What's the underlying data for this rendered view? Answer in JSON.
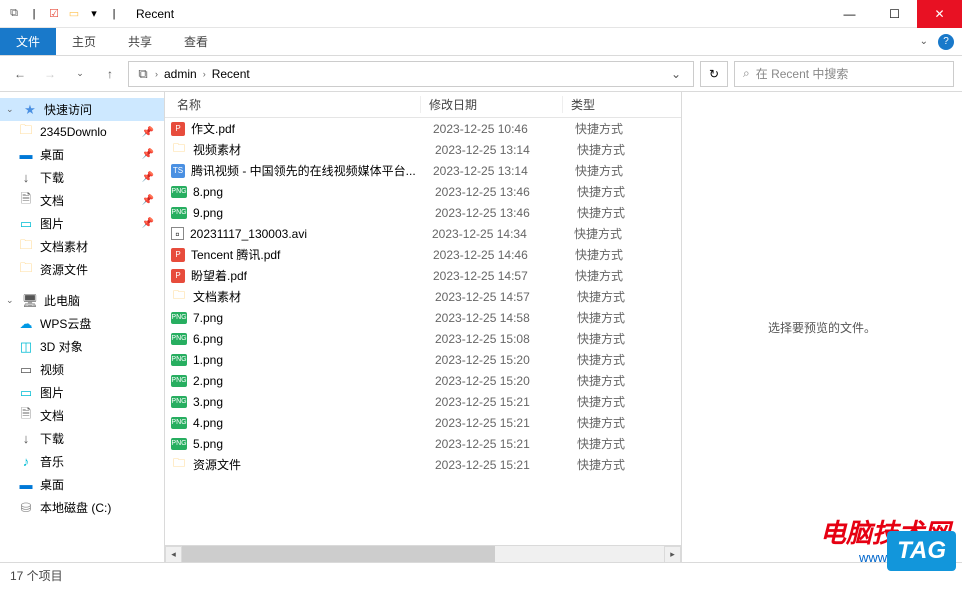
{
  "window": {
    "title": "Recent"
  },
  "ribbon": {
    "file": "文件",
    "home": "主页",
    "share": "共享",
    "view": "查看"
  },
  "address": {
    "seg1": "admin",
    "seg2": "Recent"
  },
  "search": {
    "placeholder": "在 Recent 中搜索"
  },
  "nav": {
    "quick_access": "快速访问",
    "items_quick": [
      {
        "label": "2345Downlo",
        "icon": "folder",
        "pin": true
      },
      {
        "label": "桌面",
        "icon": "desk",
        "pin": true
      },
      {
        "label": "下载",
        "icon": "down",
        "pin": true
      },
      {
        "label": "文档",
        "icon": "doc",
        "pin": true
      },
      {
        "label": "图片",
        "icon": "pic",
        "pin": true
      },
      {
        "label": "文档素材",
        "icon": "folder",
        "pin": false
      },
      {
        "label": "资源文件",
        "icon": "folder",
        "pin": false
      }
    ],
    "this_pc": "此电脑",
    "items_pc": [
      {
        "label": "WPS云盘",
        "icon": "wps"
      },
      {
        "label": "3D 对象",
        "icon": "3d"
      },
      {
        "label": "视频",
        "icon": "video"
      },
      {
        "label": "图片",
        "icon": "pic"
      },
      {
        "label": "文档",
        "icon": "doc"
      },
      {
        "label": "下载",
        "icon": "down"
      },
      {
        "label": "音乐",
        "icon": "music"
      },
      {
        "label": "桌面",
        "icon": "desk"
      },
      {
        "label": "本地磁盘 (C:)",
        "icon": "disk"
      }
    ]
  },
  "columns": {
    "name": "名称",
    "date": "修改日期",
    "type": "类型"
  },
  "files": [
    {
      "name": "作文.pdf",
      "date": "2023-12-25 10:46",
      "type": "快捷方式",
      "icon": "pdf"
    },
    {
      "name": "视频素材",
      "date": "2023-12-25 13:14",
      "type": "快捷方式",
      "icon": "folder"
    },
    {
      "name": "腾讯视频 - 中国领先的在线视频媒体平台...",
      "date": "2023-12-25 13:14",
      "type": "快捷方式",
      "icon": "ts"
    },
    {
      "name": "8.png",
      "date": "2023-12-25 13:46",
      "type": "快捷方式",
      "icon": "png"
    },
    {
      "name": "9.png",
      "date": "2023-12-25 13:46",
      "type": "快捷方式",
      "icon": "png"
    },
    {
      "name": "20231117_130003.avi",
      "date": "2023-12-25 14:34",
      "type": "快捷方式",
      "icon": "avi"
    },
    {
      "name": "Tencent 腾讯.pdf",
      "date": "2023-12-25 14:46",
      "type": "快捷方式",
      "icon": "pdf"
    },
    {
      "name": "盼望着.pdf",
      "date": "2023-12-25 14:57",
      "type": "快捷方式",
      "icon": "pdf"
    },
    {
      "name": "文档素材",
      "date": "2023-12-25 14:57",
      "type": "快捷方式",
      "icon": "folder"
    },
    {
      "name": "7.png",
      "date": "2023-12-25 14:58",
      "type": "快捷方式",
      "icon": "png"
    },
    {
      "name": "6.png",
      "date": "2023-12-25 15:08",
      "type": "快捷方式",
      "icon": "png"
    },
    {
      "name": "1.png",
      "date": "2023-12-25 15:20",
      "type": "快捷方式",
      "icon": "png"
    },
    {
      "name": "2.png",
      "date": "2023-12-25 15:20",
      "type": "快捷方式",
      "icon": "png"
    },
    {
      "name": "3.png",
      "date": "2023-12-25 15:21",
      "type": "快捷方式",
      "icon": "png"
    },
    {
      "name": "4.png",
      "date": "2023-12-25 15:21",
      "type": "快捷方式",
      "icon": "png"
    },
    {
      "name": "5.png",
      "date": "2023-12-25 15:21",
      "type": "快捷方式",
      "icon": "png"
    },
    {
      "name": "资源文件",
      "date": "2023-12-25 15:21",
      "type": "快捷方式",
      "icon": "folder"
    }
  ],
  "preview": {
    "empty": "选择要预览的文件。"
  },
  "status": {
    "count": "17 个项目"
  },
  "watermark": {
    "main": "电脑技术网",
    "sub": "www.tagxp.com",
    "tag": "TAG"
  }
}
